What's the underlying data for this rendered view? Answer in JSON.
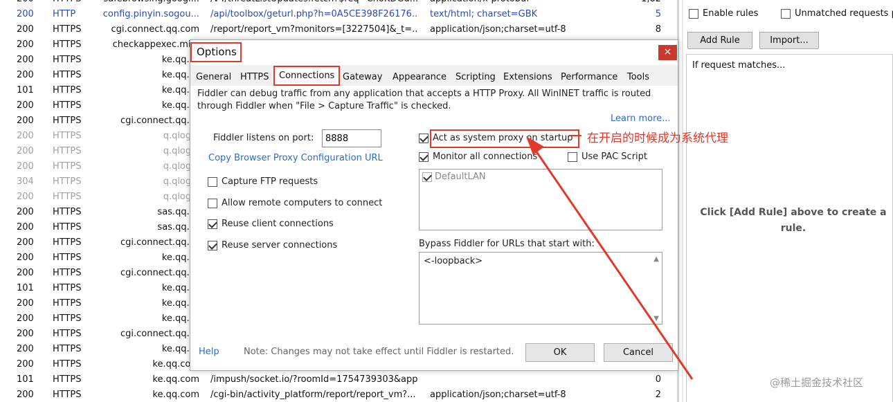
{
  "sessions": [
    {
      "result": "200",
      "protocol": "HTTPS",
      "host": "safebrowsing.googl...",
      "url": "/v4/threatListUpdates:fetch?$req=ChoKDGd...",
      "ctype": "application/x-protobuf",
      "size": "1,82",
      "style": ""
    },
    {
      "result": "200",
      "protocol": "HTTP",
      "host": "config.pinyin.sogou...",
      "url": "/api/toolbox/geturl.php?h=0A5CE398F26176...",
      "ctype": "text/html; charset=GBK",
      "size": "5",
      "style": "blue"
    },
    {
      "result": "200",
      "protocol": "HTTPS",
      "host": "cgi.connect.qq.com",
      "url": "/report/report_vm?monitors=[3227504]&_t=...",
      "ctype": "application/json;charset=utf-8",
      "size": "8",
      "style": ""
    },
    {
      "result": "200",
      "protocol": "HTTPS",
      "host": "checkappexec.micr",
      "url": "",
      "ctype": "",
      "size": "",
      "style": ""
    },
    {
      "result": "200",
      "protocol": "HTTPS",
      "host": "ke.qq.cc",
      "url": "",
      "ctype": "",
      "size": "",
      "style": ""
    },
    {
      "result": "200",
      "protocol": "HTTPS",
      "host": "ke.qq.cc",
      "url": "",
      "ctype": "",
      "size": "",
      "style": ""
    },
    {
      "result": "101",
      "protocol": "HTTPS",
      "host": "ke.qq.cc",
      "url": "",
      "ctype": "",
      "size": "",
      "style": ""
    },
    {
      "result": "200",
      "protocol": "HTTPS",
      "host": "ke.qq.cc",
      "url": "",
      "ctype": "",
      "size": "",
      "style": ""
    },
    {
      "result": "200",
      "protocol": "HTTPS",
      "host": "cgi.connect.qq.cc",
      "url": "",
      "ctype": "",
      "size": "",
      "style": ""
    },
    {
      "result": "200",
      "protocol": "HTTPS",
      "host": "q.qlogo.",
      "url": "",
      "ctype": "",
      "size": "",
      "style": "gray"
    },
    {
      "result": "200",
      "protocol": "HTTPS",
      "host": "q.qlogo.",
      "url": "",
      "ctype": "",
      "size": "",
      "style": "gray"
    },
    {
      "result": "200",
      "protocol": "HTTPS",
      "host": "q.qlogo.",
      "url": "",
      "ctype": "",
      "size": "",
      "style": "gray"
    },
    {
      "result": "304",
      "protocol": "HTTPS",
      "host": "q.qlogo.",
      "url": "",
      "ctype": "",
      "size": "",
      "style": "gray"
    },
    {
      "result": "200",
      "protocol": "HTTPS",
      "host": "q.qlogo.",
      "url": "",
      "ctype": "",
      "size": "",
      "style": "gray"
    },
    {
      "result": "200",
      "protocol": "HTTPS",
      "host": "sas.qq.cc",
      "url": "",
      "ctype": "",
      "size": "",
      "style": ""
    },
    {
      "result": "200",
      "protocol": "HTTPS",
      "host": "sas.qq.cc",
      "url": "",
      "ctype": "",
      "size": "",
      "style": ""
    },
    {
      "result": "200",
      "protocol": "HTTPS",
      "host": "cgi.connect.qq.cc",
      "url": "",
      "ctype": "",
      "size": "",
      "style": ""
    },
    {
      "result": "200",
      "protocol": "HTTPS",
      "host": "ke.qq.cc",
      "url": "",
      "ctype": "",
      "size": "",
      "style": ""
    },
    {
      "result": "200",
      "protocol": "HTTPS",
      "host": "cgi.connect.qq.cc",
      "url": "",
      "ctype": "",
      "size": "",
      "style": ""
    },
    {
      "result": "101",
      "protocol": "HTTPS",
      "host": "ke.qq.cc",
      "url": "",
      "ctype": "",
      "size": "",
      "style": ""
    },
    {
      "result": "200",
      "protocol": "HTTPS",
      "host": "ke.qq.cc",
      "url": "",
      "ctype": "",
      "size": "",
      "style": ""
    },
    {
      "result": "200",
      "protocol": "HTTPS",
      "host": "ke.qq.cc",
      "url": "",
      "ctype": "",
      "size": "",
      "style": ""
    },
    {
      "result": "200",
      "protocol": "HTTPS",
      "host": "cgi.connect.qq.cc",
      "url": "",
      "ctype": "",
      "size": "",
      "style": ""
    },
    {
      "result": "200",
      "protocol": "HTTPS",
      "host": "ke.qq.cc",
      "url": "",
      "ctype": "",
      "size": "",
      "style": ""
    },
    {
      "result": "200",
      "protocol": "HTTPS",
      "host": "ke.qq.com",
      "url": "/cgi-bin/activity_platform/report/report_vm?...",
      "ctype": "application/json;charset=utf-8",
      "size": "2",
      "style": ""
    },
    {
      "result": "101",
      "protocol": "HTTPS",
      "host": "ke.qq.com",
      "url": "/impush/socket.io/?roomId=1754739303&app...",
      "ctype": "",
      "size": "0",
      "style": ""
    },
    {
      "result": "200",
      "protocol": "HTTPS",
      "host": "ke.qq.com",
      "url": "/cgi-bin/activity_platform/report/report_vm?...",
      "ctype": "application/json;charset=utf-8",
      "size": "2",
      "style": ""
    }
  ],
  "right_panel": {
    "enable_rules": "Enable rules",
    "unmatched": "Unmatched requests p",
    "add_rule": "Add Rule",
    "import": "Import...",
    "if_matches": "If request matches...",
    "hint": "Click [Add Rule] above to create a rule."
  },
  "dialog": {
    "title": "Options",
    "close": "×",
    "tabs": [
      "General",
      "HTTPS",
      "Connections",
      "Gateway",
      "Appearance",
      "Scripting",
      "Extensions",
      "Performance",
      "Tools"
    ],
    "active_tab": "Connections",
    "description": "Fiddler can debug traffic from any application that accepts a HTTP Proxy. All WinINET traffic is routed through Fiddler when \"File > Capture Traffic\" is checked.",
    "learn_more": "Learn more...",
    "port_label": "Fiddler listens on port:",
    "port_value": "8888",
    "copy_url": "Copy Browser Proxy Configuration URL",
    "options_left": [
      {
        "label": "Capture FTP requests",
        "checked": false
      },
      {
        "label": "Allow remote computers to connect",
        "checked": false
      },
      {
        "label": "Reuse client connections",
        "checked": true
      },
      {
        "label": "Reuse server connections",
        "checked": true
      }
    ],
    "act_as_proxy": "Act as system proxy on startup",
    "monitor_all": "Monitor all connections",
    "use_pac": "Use PAC Script",
    "lan_item": "DefaultLAN",
    "bypass_label": "Bypass Fiddler for URLs that start with:",
    "bypass_value": "<-loopback>",
    "help": "Help",
    "note": "Note: Changes may not take effect until Fiddler is restarted.",
    "ok": "OK",
    "cancel": "Cancel"
  },
  "annotation": {
    "text": "在开启的时候成为系统代理",
    "color": "#e2382a"
  },
  "watermark": "@稀土掘金技术社区"
}
